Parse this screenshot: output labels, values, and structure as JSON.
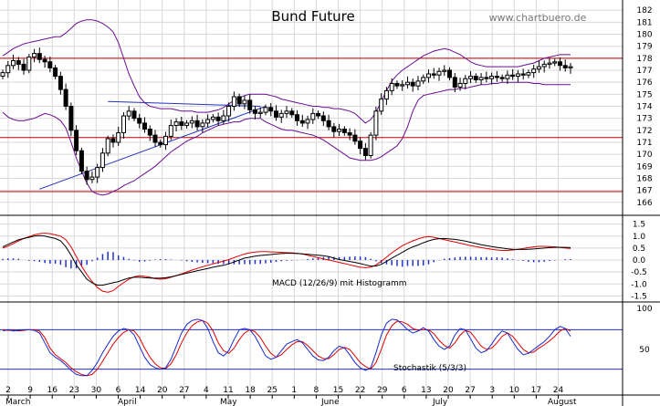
{
  "header": {
    "title": "Bund Future",
    "watermark": "www.chartbuero.de"
  },
  "labels": {
    "macd": "MACD (12/26/9) mit Histogramm",
    "stochastic": "Stochastik (5/3/3)"
  },
  "colors": {
    "background": "#ffffff",
    "grid": "#d8d8d8",
    "candle": "#000000",
    "bollinger": "#6a0d91",
    "resistance": "#c00000",
    "trendline": "#2233bb",
    "macd_line": "#000000",
    "signal_line": "#e00000",
    "histogram": "#2233cc",
    "stoch_k": "#1a2acc",
    "stoch_d": "#e00000",
    "stoch_levels": "#2233bb"
  },
  "chart_data": [
    {
      "type": "candlestick",
      "title": "Bund Future",
      "y_ticks": [
        166,
        167,
        168,
        169,
        170,
        171,
        172,
        173,
        174,
        175,
        176,
        177,
        178,
        179,
        180,
        181,
        182
      ],
      "ylim": [
        165.3,
        182.7
      ],
      "x_tick_labels": [
        "2",
        "9",
        "16",
        "23",
        "30",
        "6",
        "14",
        "20",
        "27",
        "4",
        "11",
        "18",
        "25",
        "1",
        "8",
        "15",
        "22",
        "29",
        "6",
        "13",
        "20",
        "27",
        "3",
        "10",
        "17",
        "24"
      ],
      "month_labels": [
        "March",
        "April",
        "May",
        "June",
        "July",
        "August"
      ],
      "horizontal_lines": [
        178.0,
        171.4,
        166.9
      ],
      "trendlines": [
        {
          "from": [
            7,
            167.1
          ],
          "to": [
            50,
            174.0
          ]
        },
        {
          "from": [
            20,
            174.4
          ],
          "to": [
            49,
            174.0
          ]
        }
      ],
      "close": [
        176.8,
        177.4,
        177.8,
        177.5,
        177.0,
        178.1,
        178.4,
        177.9,
        177.7,
        177.2,
        176.5,
        175.4,
        174.0,
        172.0,
        170.3,
        168.6,
        167.9,
        168.1,
        168.9,
        170.1,
        171.3,
        171.0,
        171.8,
        173.2,
        173.6,
        173.0,
        172.6,
        172.1,
        171.6,
        171.0,
        170.8,
        171.5,
        172.4,
        172.7,
        172.4,
        172.6,
        172.8,
        172.3,
        172.6,
        172.9,
        173.1,
        172.8,
        173.2,
        174.0,
        174.8,
        174.2,
        174.5,
        173.7,
        173.4,
        173.5,
        173.9,
        173.6,
        173.1,
        173.4,
        173.6,
        173.3,
        172.8,
        172.6,
        172.9,
        173.4,
        173.2,
        172.8,
        172.3,
        171.9,
        172.1,
        171.8,
        171.6,
        171.1,
        170.5,
        169.9,
        171.6,
        173.6,
        174.6,
        175.3,
        175.9,
        175.7,
        175.8,
        176.0,
        175.7,
        176.1,
        176.4,
        176.7,
        176.6,
        176.9,
        177.0,
        176.4,
        175.6,
        175.9,
        176.3,
        176.5,
        176.2,
        176.4,
        176.3,
        176.5,
        176.4,
        176.3,
        176.6,
        176.5,
        176.7,
        176.6,
        176.8,
        177.1,
        177.3,
        177.5,
        177.6,
        177.7,
        177.4,
        177.2,
        177.3
      ],
      "bollinger_upper": [
        178.2,
        178.5,
        178.8,
        179.0,
        179.2,
        179.3,
        179.4,
        179.5,
        179.6,
        179.7,
        179.8,
        179.8,
        180.1,
        180.5,
        180.9,
        181.1,
        181.2,
        181.2,
        181.1,
        180.9,
        180.6,
        180.2,
        179.3,
        178.0,
        176.7,
        175.7,
        174.8,
        174.3,
        174.0,
        173.9,
        173.8,
        173.8,
        173.8,
        173.7,
        173.6,
        173.6,
        173.6,
        173.5,
        173.5,
        173.5,
        173.6,
        173.7,
        173.9,
        174.2,
        174.5,
        174.7,
        174.9,
        175.0,
        175.0,
        175.0,
        175.0,
        174.9,
        174.8,
        174.6,
        174.5,
        174.4,
        174.3,
        174.2,
        174.1,
        174.0,
        174.0,
        173.9,
        173.9,
        173.8,
        173.8,
        173.7,
        173.6,
        173.4,
        173.0,
        172.6,
        172.9,
        173.5,
        174.4,
        175.3,
        176.1,
        176.6,
        177.0,
        177.3,
        177.6,
        177.9,
        178.2,
        178.4,
        178.6,
        178.7,
        178.8,
        178.7,
        178.5,
        178.3,
        178.0,
        177.7,
        177.5,
        177.4,
        177.3,
        177.3,
        177.3,
        177.3,
        177.3,
        177.3,
        177.3,
        177.4,
        177.5,
        177.6,
        177.8,
        178.0,
        178.1,
        178.2,
        178.3,
        178.3,
        178.3
      ],
      "bollinger_lower": [
        173.5,
        173.1,
        172.9,
        172.8,
        172.8,
        172.9,
        173.0,
        173.2,
        173.4,
        173.3,
        173.1,
        172.8,
        172.2,
        171.0,
        169.7,
        168.6,
        167.6,
        166.9,
        166.7,
        166.6,
        166.7,
        166.9,
        167.1,
        167.4,
        167.6,
        167.8,
        168.1,
        168.4,
        168.7,
        169.0,
        169.4,
        169.8,
        170.2,
        170.5,
        170.8,
        171.1,
        171.3,
        171.5,
        171.8,
        172.0,
        172.2,
        172.4,
        172.5,
        172.6,
        172.7,
        172.7,
        172.9,
        173.0,
        173.0,
        173.0,
        172.7,
        172.5,
        172.3,
        172.1,
        172.0,
        172.0,
        171.9,
        171.8,
        171.7,
        171.6,
        171.4,
        171.2,
        170.9,
        170.6,
        170.3,
        170.0,
        169.7,
        169.6,
        169.5,
        169.5,
        169.5,
        169.6,
        169.8,
        170.1,
        170.4,
        170.7,
        171.3,
        172.3,
        173.6,
        174.5,
        174.9,
        175.0,
        175.1,
        175.2,
        175.3,
        175.4,
        175.4,
        175.5,
        175.5,
        175.6,
        175.7,
        175.8,
        175.8,
        175.9,
        175.9,
        176.0,
        176.0,
        176.0,
        176.0,
        176.0,
        176.0,
        175.9,
        175.9,
        175.8,
        175.8,
        175.8,
        175.8,
        175.8,
        175.8
      ]
    },
    {
      "type": "line",
      "title": "MACD (12/26/9) mit Histogramm",
      "y_ticks": [
        -1.5,
        -1.0,
        -0.5,
        0.0,
        0.5,
        1.0,
        1.5
      ],
      "ylim": [
        -1.6,
        1.6
      ],
      "macd": [
        0.55,
        0.65,
        0.75,
        0.85,
        0.9,
        0.95,
        1.0,
        1.02,
        1.0,
        0.95,
        0.9,
        0.8,
        0.55,
        0.2,
        -0.2,
        -0.5,
        -0.8,
        -0.95,
        -1.05,
        -1.05,
        -1.0,
        -0.95,
        -0.9,
        -0.82,
        -0.75,
        -0.72,
        -0.72,
        -0.74,
        -0.75,
        -0.76,
        -0.76,
        -0.74,
        -0.7,
        -0.65,
        -0.6,
        -0.55,
        -0.5,
        -0.45,
        -0.4,
        -0.35,
        -0.3,
        -0.26,
        -0.22,
        -0.16,
        -0.08,
        0.0,
        0.08,
        0.12,
        0.16,
        0.19,
        0.21,
        0.23,
        0.25,
        0.27,
        0.28,
        0.28,
        0.27,
        0.26,
        0.24,
        0.22,
        0.2,
        0.18,
        0.14,
        0.08,
        0.02,
        -0.02,
        -0.06,
        -0.1,
        -0.15,
        -0.2,
        -0.25,
        -0.25,
        -0.18,
        -0.06,
        0.08,
        0.2,
        0.32,
        0.45,
        0.55,
        0.63,
        0.72,
        0.8,
        0.86,
        0.89,
        0.9,
        0.88,
        0.86,
        0.83,
        0.79,
        0.74,
        0.69,
        0.64,
        0.6,
        0.56,
        0.53,
        0.5,
        0.47,
        0.45,
        0.44,
        0.44,
        0.45,
        0.46,
        0.48,
        0.5,
        0.52,
        0.53,
        0.53,
        0.53,
        0.52
      ],
      "signal": [
        0.5,
        0.58,
        0.68,
        0.8,
        0.9,
        0.98,
        1.05,
        1.1,
        1.12,
        1.1,
        1.05,
        1.0,
        0.85,
        0.55,
        0.15,
        -0.25,
        -0.6,
        -0.9,
        -1.15,
        -1.3,
        -1.35,
        -1.28,
        -1.1,
        -0.95,
        -0.8,
        -0.7,
        -0.65,
        -0.68,
        -0.72,
        -0.78,
        -0.8,
        -0.78,
        -0.72,
        -0.65,
        -0.58,
        -0.5,
        -0.42,
        -0.35,
        -0.28,
        -0.22,
        -0.16,
        -0.1,
        -0.05,
        0.02,
        0.1,
        0.18,
        0.25,
        0.3,
        0.33,
        0.35,
        0.35,
        0.34,
        0.33,
        0.32,
        0.31,
        0.3,
        0.28,
        0.25,
        0.2,
        0.15,
        0.1,
        0.05,
        0.0,
        -0.05,
        -0.1,
        -0.15,
        -0.2,
        -0.25,
        -0.3,
        -0.32,
        -0.3,
        -0.2,
        -0.05,
        0.12,
        0.3,
        0.45,
        0.6,
        0.7,
        0.8,
        0.88,
        0.95,
        0.98,
        0.95,
        0.9,
        0.85,
        0.8,
        0.75,
        0.7,
        0.65,
        0.6,
        0.56,
        0.52,
        0.48,
        0.45,
        0.42,
        0.4,
        0.4,
        0.42,
        0.45,
        0.48,
        0.52,
        0.55,
        0.57,
        0.57,
        0.56,
        0.55,
        0.53,
        0.5,
        0.48
      ],
      "histogram": [
        0.05,
        0.07,
        0.07,
        0.05,
        0.0,
        -0.03,
        -0.05,
        -0.08,
        -0.12,
        -0.15,
        -0.15,
        -0.2,
        -0.3,
        -0.35,
        -0.35,
        -0.25,
        -0.2,
        -0.05,
        0.1,
        0.25,
        0.35,
        0.33,
        0.2,
        0.13,
        0.05,
        -0.02,
        -0.07,
        -0.06,
        -0.03,
        0.02,
        0.04,
        0.04,
        0.02,
        0.0,
        -0.02,
        -0.05,
        -0.08,
        -0.1,
        -0.12,
        -0.13,
        -0.14,
        -0.16,
        -0.17,
        -0.18,
        -0.18,
        -0.18,
        -0.17,
        -0.18,
        -0.17,
        -0.16,
        -0.14,
        -0.11,
        -0.08,
        -0.05,
        -0.03,
        -0.02,
        -0.01,
        0.01,
        0.04,
        0.07,
        0.1,
        0.13,
        0.14,
        0.13,
        0.12,
        0.13,
        0.14,
        0.15,
        0.15,
        0.12,
        0.05,
        -0.05,
        -0.13,
        -0.18,
        -0.22,
        -0.25,
        -0.28,
        -0.25,
        -0.25,
        -0.25,
        -0.23,
        -0.18,
        -0.09,
        -0.01,
        0.05,
        0.08,
        0.11,
        0.13,
        0.14,
        0.14,
        0.13,
        0.12,
        0.12,
        0.11,
        0.11,
        0.1,
        0.07,
        0.03,
        -0.01,
        -0.04,
        -0.07,
        -0.09,
        -0.09,
        -0.07,
        -0.04,
        -0.02,
        0.0,
        0.03,
        0.04
      ]
    },
    {
      "type": "line",
      "title": "Stochastik (5/3/3)",
      "y_ticks": [
        50
      ],
      "ylim": [
        0,
        100
      ],
      "levels": [
        80,
        20
      ],
      "k": [
        78,
        80,
        78,
        79,
        80,
        80,
        79,
        75,
        60,
        45,
        38,
        33,
        26,
        18,
        12,
        10,
        10,
        18,
        30,
        45,
        58,
        70,
        78,
        82,
        80,
        72,
        55,
        38,
        27,
        22,
        20,
        22,
        35,
        55,
        75,
        88,
        94,
        96,
        94,
        82,
        62,
        45,
        40,
        48,
        65,
        80,
        82,
        80,
        70,
        55,
        40,
        35,
        38,
        48,
        58,
        62,
        65,
        60,
        50,
        40,
        34,
        33,
        38,
        48,
        55,
        52,
        42,
        30,
        22,
        18,
        22,
        45,
        72,
        90,
        96,
        95,
        88,
        80,
        75,
        78,
        83,
        78,
        65,
        55,
        50,
        55,
        72,
        82,
        80,
        66,
        52,
        45,
        48,
        58,
        70,
        78,
        75,
        62,
        50,
        42,
        44,
        50,
        56,
        62,
        70,
        80,
        85,
        82,
        70
      ],
      "d": [
        80,
        79,
        79,
        78,
        79,
        80,
        80,
        78,
        68,
        52,
        42,
        36,
        30,
        22,
        16,
        12,
        10,
        12,
        20,
        32,
        45,
        58,
        68,
        76,
        80,
        78,
        68,
        52,
        38,
        28,
        22,
        21,
        28,
        42,
        60,
        75,
        86,
        92,
        94,
        90,
        78,
        60,
        48,
        44,
        52,
        65,
        75,
        80,
        77,
        68,
        55,
        44,
        38,
        42,
        50,
        57,
        62,
        62,
        56,
        48,
        40,
        36,
        36,
        42,
        50,
        53,
        50,
        40,
        30,
        24,
        20,
        30,
        50,
        72,
        86,
        93,
        92,
        88,
        82,
        79,
        80,
        80,
        74,
        64,
        56,
        52,
        60,
        72,
        79,
        76,
        66,
        55,
        50,
        52,
        60,
        70,
        75,
        70,
        60,
        50,
        45,
        46,
        52,
        57,
        63,
        70,
        78,
        82,
        78
      ]
    }
  ]
}
